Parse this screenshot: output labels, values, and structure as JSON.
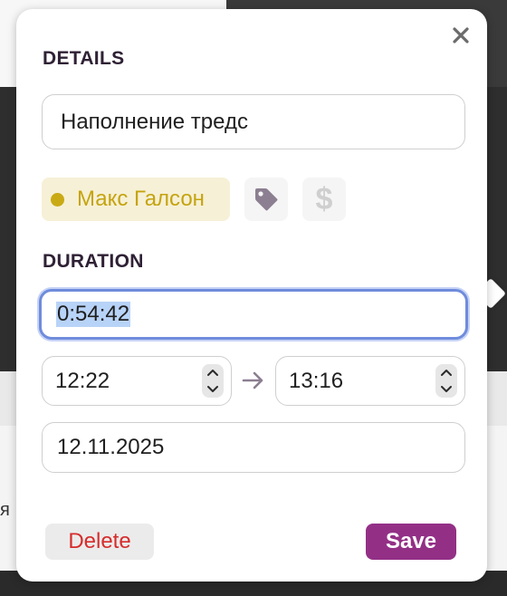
{
  "background": {
    "partial_text": "я"
  },
  "details": {
    "label": "DETAILS",
    "title_value": "Наполнение тредс",
    "assignee": {
      "name": "Макс Галсон",
      "color": "#c9aa14"
    },
    "tag_icon": "tag-icon",
    "billable_icon": "dollar-icon",
    "billable_glyph": "$"
  },
  "duration": {
    "label": "DURATION",
    "value": "0:54:42",
    "start_time": "12:22",
    "end_time": "13:16",
    "date": "12.11.2025"
  },
  "actions": {
    "delete_label": "Delete",
    "save_label": "Save"
  },
  "colors": {
    "save_button": "#933086",
    "delete_text": "#d62c2c",
    "focus_ring": "#6f8cdc"
  }
}
